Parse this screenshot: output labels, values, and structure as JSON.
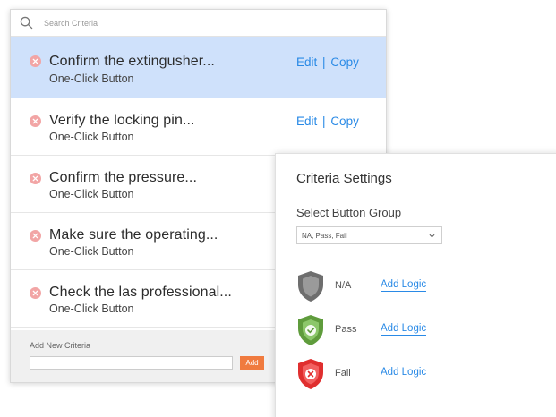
{
  "search": {
    "placeholder": "Search Criteria"
  },
  "items": [
    {
      "title": "Confirm the extingusher...",
      "subtitle": "One-Click Button",
      "edit": "Edit",
      "sep": "|",
      "copy": "Copy"
    },
    {
      "title": "Verify the locking pin...",
      "subtitle": "One-Click Button",
      "edit": "Edit",
      "sep": "|",
      "copy": "Copy"
    },
    {
      "title": "Confirm the pressure...",
      "subtitle": "One-Click Button"
    },
    {
      "title": "Make sure the operating...",
      "subtitle": "One-Click Button"
    },
    {
      "title": "Check the las professional...",
      "subtitle": "One-Click Button"
    }
  ],
  "footer": {
    "label": "Add New Criteria",
    "input_value": "",
    "button": "Add"
  },
  "settings": {
    "heading": "Criteria Settings",
    "group_label": "Select Button Group",
    "group_value": "NA, Pass, Fail",
    "options": [
      {
        "name": "N/A",
        "logic": "Add Logic",
        "color": "#7a7a7a",
        "icon": "shield-neutral-icon"
      },
      {
        "name": "Pass",
        "logic": "Add Logic",
        "color": "#6fae4a",
        "icon": "shield-check-icon"
      },
      {
        "name": "Fail",
        "logic": "Add Logic",
        "color": "#e03b3b",
        "icon": "shield-x-icon"
      }
    ]
  },
  "colors": {
    "accent": "#2a8ae6",
    "selected_row": "#cfe1fb",
    "delete_icon": "#f2a5a5",
    "add_button": "#f07b3f"
  }
}
